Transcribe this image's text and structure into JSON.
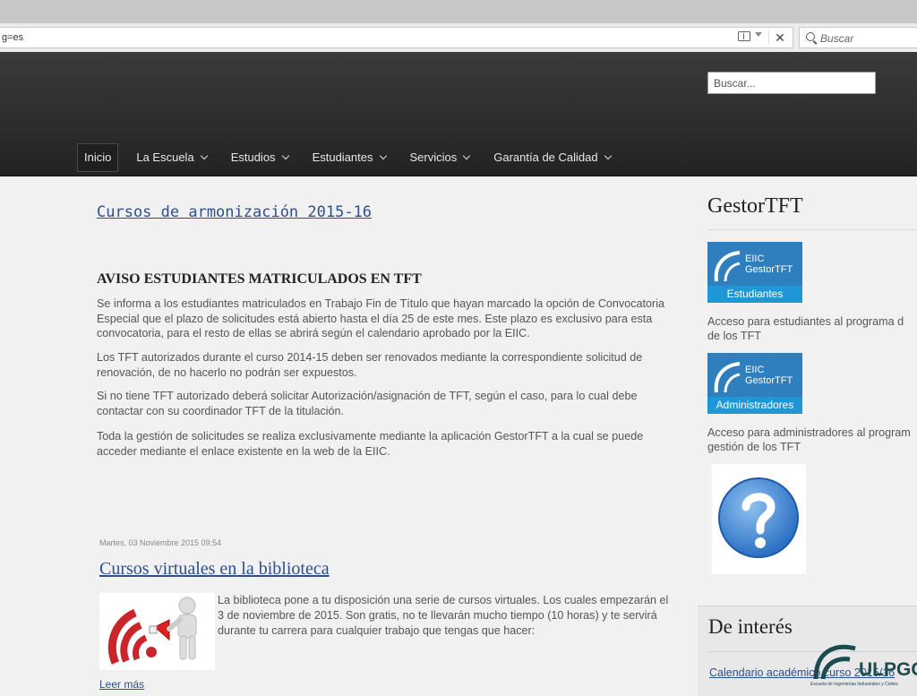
{
  "browser": {
    "url": "g=es",
    "search_placeholder": "Buscar"
  },
  "header": {
    "search_placeholder": "Buscar...",
    "nav": [
      {
        "label": "Inicio",
        "active": true
      },
      {
        "label": "La Escuela"
      },
      {
        "label": "Estudios"
      },
      {
        "label": "Estudiantes"
      },
      {
        "label": "Servicios"
      },
      {
        "label": "Garantía de Calidad"
      }
    ]
  },
  "main": {
    "article1_title": "Cursos de armonización 2015-16",
    "article2_heading": "AVISO ESTUDIANTES MATRICULADOS EN TFT",
    "paragraphs": [
      "Se informa a los estudiantes matriculados en Trabajo Fin de Título que hayan marcado la opción de Convocatoria Especial que el plazo de solicitudes está abierto hasta el día 25 de este mes. Este plazo es exclusivo para esta convocatoria, para el resto de ellas se abrirá según el calendario aprobado por la EIIC.",
      "Los TFT autorizados durante el curso 2014-15 deben ser renovados mediante la correspondiente solicitud de renovación, de no hacerlo no podrán ser expuestos.",
      "Si no tiene TFT autorizado deberá solicitar Autorización/asignación de TFT, según el caso, para lo cual debe contactar con su coordinador TFT de la titulación.",
      "Toda la gestión de solicitudes se realiza exclusivamente mediante la aplicación GestorTFT a la cual se puede acceder mediante el enlace existente en la web de la EIIC."
    ],
    "article3_date": "Martes, 03 Noviembre 2015 09:54",
    "article3_title": "Cursos virtuales en la biblioteca",
    "article3_text": "La biblioteca pone a tu disposición una serie de cursos virtuales. Los cuales empezarán el 3 de noviembre de 2015. Son gratis, no te llevarán mucho tiempo (10 horas) y te servirá durante tu carrera para cualquier trabajo que tengas que hacer:",
    "read_more": "Leer más"
  },
  "sidebar": {
    "gestor_title": "GestorTFT",
    "logo_eiic": "EIIC",
    "logo_gestor": "GestorTFT",
    "students_logo_label": "Estudiantes",
    "students_text_1": "Acceso para estudiantes al programa d",
    "students_text_2": "de los TFT",
    "admins_logo_label": "Administradores",
    "admins_text_1": "Acceso para administradores al program",
    "admins_text_2": "gestión de los TFT",
    "interes_title": "De interés",
    "interes_link": "Calendario académico curso 2015/16",
    "ulpgc_name": "ULPGC",
    "ulpgc_sub": "Escuela de Ingenierías Industriales y Civiles"
  },
  "colors": {
    "link": "#2e4f8a",
    "header_bg": "#2b2b2b",
    "logo_blue": "#2f7fbf",
    "logo_sub_blue": "#1f97d6"
  }
}
